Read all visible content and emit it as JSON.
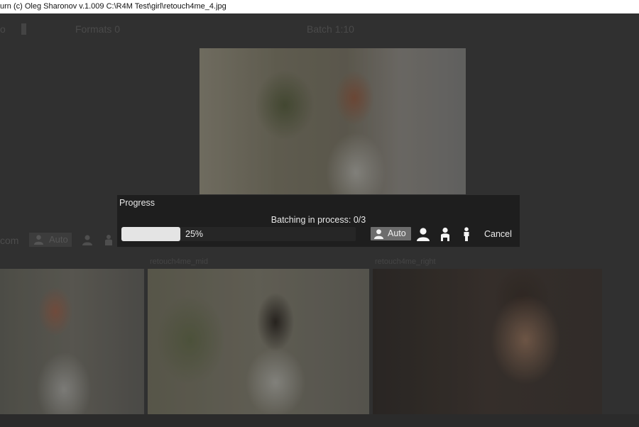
{
  "window": {
    "title": "urn (c) Oleg Sharonov v.1.009 C:\\R4M Test\\girl\\retouch4me_4.jpg"
  },
  "background": {
    "toolbar": {
      "left_text": "o",
      "center_text": "Formats 0",
      "right_text": "Batch 1:10"
    },
    "side_text": "com",
    "side_auto_label": "Auto",
    "thumb_labels": [
      "retouch4me_mid",
      "retouch4me_right"
    ]
  },
  "progress_dialog": {
    "title": "Progress",
    "status": "Batching in process: 0/3",
    "percent_text": "25%",
    "progress_value": 0.25,
    "auto_label": "Auto",
    "cancel_label": "Cancel"
  },
  "colors": {
    "dialog_bg": "#1e1e1e",
    "progress_fill": "#e4e4e4",
    "auto_button_bg": "#6d6d6d"
  },
  "icons": [
    "person-portrait-icon",
    "person-half-icon",
    "person-full-icon"
  ]
}
